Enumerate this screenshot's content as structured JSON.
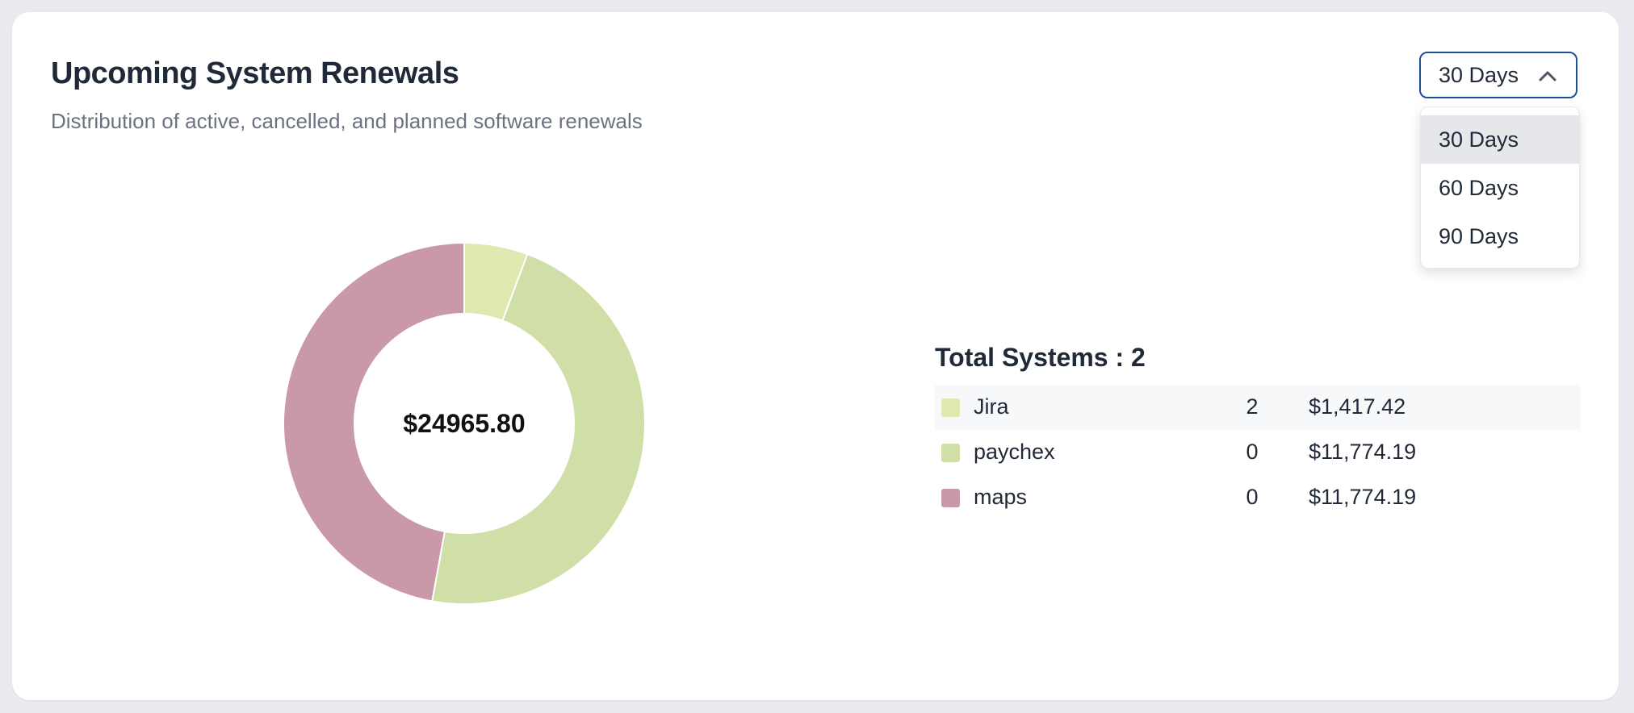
{
  "header": {
    "title": "Upcoming System Renewals",
    "subtitle": "Distribution of active, cancelled, and planned software renewals"
  },
  "period_select": {
    "value": "30 Days",
    "options": [
      "30 Days",
      "60 Days",
      "90 Days"
    ],
    "selected_index": 0
  },
  "summary": {
    "total_label": "Total Systems : 2"
  },
  "chart_data": {
    "type": "pie",
    "donut": true,
    "center_label": "$24965.80",
    "categories": [
      "Jira",
      "paychex",
      "maps"
    ],
    "values": [
      1417.42,
      11774.19,
      11774.19
    ],
    "counts": [
      2,
      0,
      0
    ],
    "amount_labels": [
      "$1,417.42",
      "$11,774.19",
      "$11,774.19"
    ],
    "colors": [
      "#dfe8b0",
      "#d0dfa7",
      "#c999a7"
    ],
    "legend_position": "right"
  }
}
